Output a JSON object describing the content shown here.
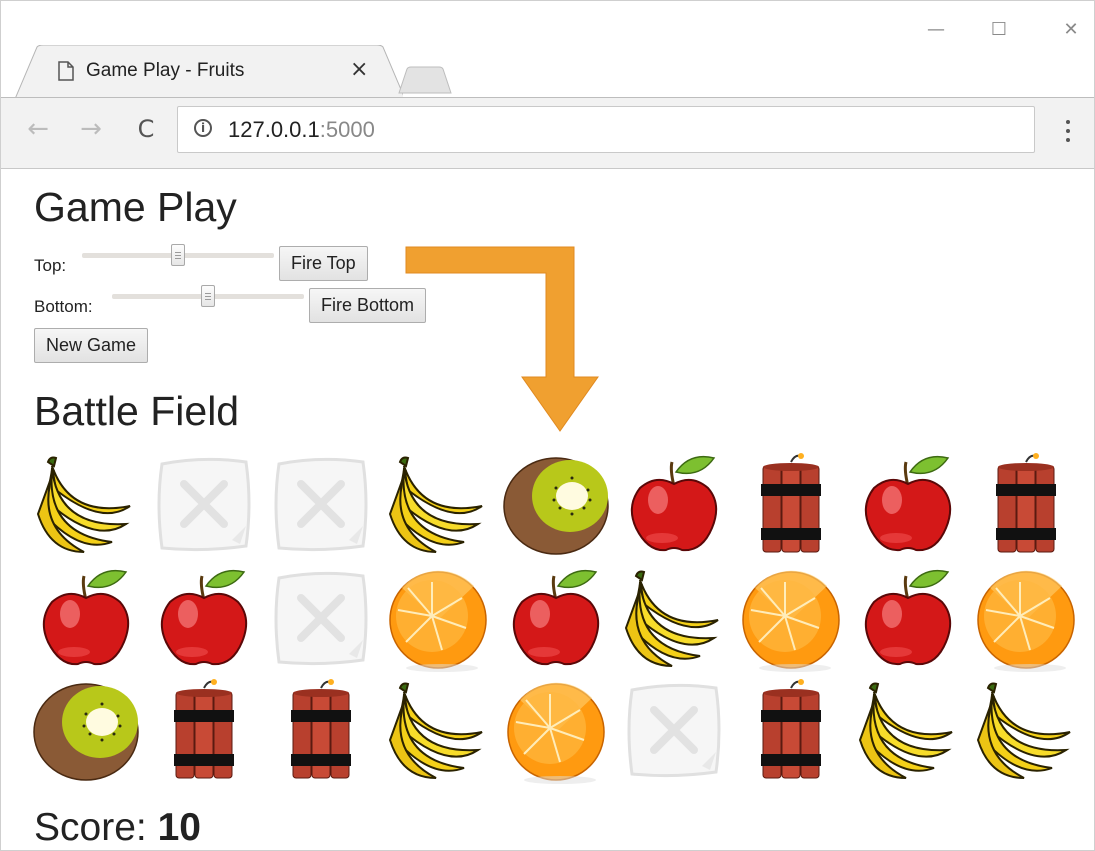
{
  "browser": {
    "tab_title": "Game Play - Fruits",
    "tab_close": "×",
    "url_host": "127.0.0.1",
    "url_port": ":5000",
    "window_controls": {
      "minimize": "—",
      "maximize": "☐",
      "close": "✕"
    },
    "nav": {
      "back": "←",
      "forward": "→",
      "reload": "C"
    },
    "info_icon": "i"
  },
  "controls": {
    "heading": "Game Play",
    "top_label": "Top:",
    "top_slider_value": 0.5,
    "fire_top": "Fire Top",
    "bottom_label": "Bottom:",
    "bottom_slider_value": 0.5,
    "fire_bottom": "Fire Bottom",
    "new_game": "New Game"
  },
  "battlefield": {
    "heading": "Battle Field",
    "grid": [
      [
        "banana",
        "empty",
        "empty",
        "banana",
        "kiwi",
        "apple",
        "dynamite",
        "apple",
        "dynamite"
      ],
      [
        "apple",
        "apple",
        "empty",
        "orange",
        "apple",
        "banana",
        "orange",
        "apple",
        "orange"
      ],
      [
        "kiwi",
        "dynamite",
        "dynamite",
        "banana",
        "orange",
        "empty",
        "dynamite",
        "banana",
        "banana"
      ]
    ]
  },
  "score": {
    "label": "Score:",
    "value": "10"
  },
  "colors": {
    "arrow": "#f0a030",
    "apple": "#d41818",
    "orange": "#ff9a10",
    "banana": "#f4d018",
    "kiwi_flesh": "#b8c81a",
    "dynamite": "#b8402e"
  }
}
